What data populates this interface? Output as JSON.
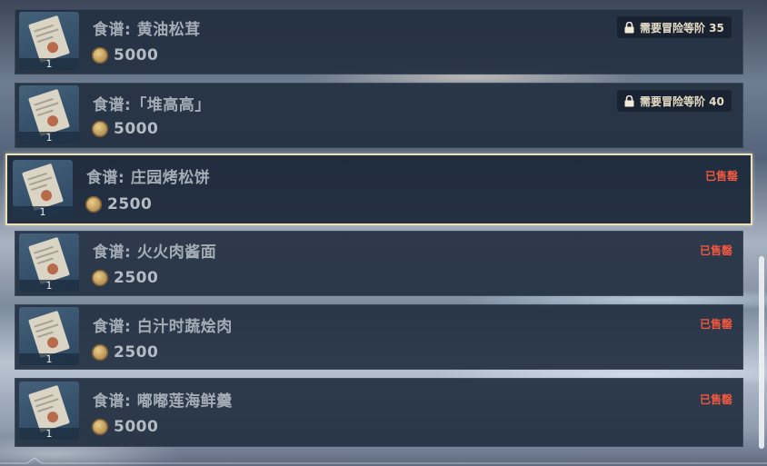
{
  "shop_items": [
    {
      "name": "食谱: 黄油松茸",
      "quantity": "1",
      "price": "5000",
      "status": "locked",
      "lock_text": "需要冒险等阶 35"
    },
    {
      "name": "食谱:「堆高高」",
      "quantity": "1",
      "price": "5000",
      "status": "locked",
      "lock_text": "需要冒险等阶 40"
    },
    {
      "name": "食谱: 庄园烤松饼",
      "quantity": "1",
      "price": "2500",
      "status": "sold_out",
      "sold_text": "已售罄",
      "selected": true
    },
    {
      "name": "食谱: 火火肉酱面",
      "quantity": "1",
      "price": "2500",
      "status": "sold_out",
      "sold_text": "已售罄"
    },
    {
      "name": "食谱: 白汁时蔬烩肉",
      "quantity": "1",
      "price": "2500",
      "status": "sold_out",
      "sold_text": "已售罄"
    },
    {
      "name": "食谱: 嘟嘟莲海鲜羹",
      "quantity": "1",
      "price": "5000",
      "status": "sold_out",
      "sold_text": "已售罄"
    }
  ],
  "icons": {
    "item_thumbnail": "recipe-scroll-icon",
    "currency": "mora-coin-icon",
    "lock": "lock-icon"
  },
  "colors": {
    "sold_out": "#f0573f",
    "selected_border": "#ece0b8",
    "lock_badge_text": "#e6dcc6"
  }
}
